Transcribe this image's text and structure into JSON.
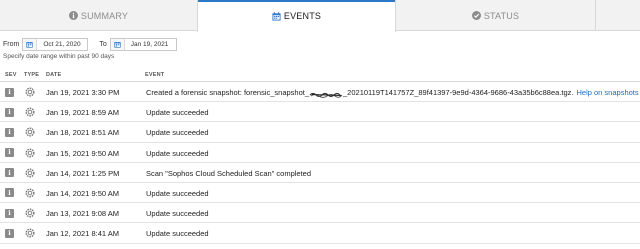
{
  "tabs": [
    {
      "label": "SUMMARY",
      "icon": "info-circle-icon",
      "active": false
    },
    {
      "label": "EVENTS",
      "icon": "calendar-icon",
      "active": true
    },
    {
      "label": "STATUS",
      "icon": "check-circle-icon",
      "active": false
    }
  ],
  "filters": {
    "from_label": "From",
    "from_value": "Oct 21, 2020",
    "to_label": "To",
    "to_value": "Jan 19, 2021",
    "hint": "Specify date range within past 90 days"
  },
  "table": {
    "columns": [
      "SEV",
      "TYPE",
      "DATE",
      "EVENT"
    ],
    "rows": [
      {
        "sev": "i",
        "type_icon": "gear-icon",
        "date": "Jan 19, 2021 3:30 PM",
        "event_prefix": "Created a forensic snapshot: forensic_snapshot_",
        "event_suffix": "_20210119T141757Z_89f41397-9e9d-4364-9686-43a35b6c88ea.tgz.",
        "link": "Help on snapshots"
      },
      {
        "sev": "i",
        "type_icon": "gear-icon",
        "date": "Jan 19, 2021 8:59 AM",
        "event": "Update succeeded"
      },
      {
        "sev": "i",
        "type_icon": "gear-icon",
        "date": "Jan 18, 2021 8:51 AM",
        "event": "Update succeeded"
      },
      {
        "sev": "i",
        "type_icon": "gear-icon",
        "date": "Jan 15, 2021 9:50 AM",
        "event": "Update succeeded"
      },
      {
        "sev": "i",
        "type_icon": "gear-icon",
        "date": "Jan 14, 2021 1:25 PM",
        "event": "Scan \"Sophos Cloud Scheduled Scan\" completed"
      },
      {
        "sev": "i",
        "type_icon": "gear-icon",
        "date": "Jan 14, 2021 9:50 AM",
        "event": "Update succeeded"
      },
      {
        "sev": "i",
        "type_icon": "gear-icon",
        "date": "Jan 13, 2021 9:08 AM",
        "event": "Update succeeded"
      },
      {
        "sev": "i",
        "type_icon": "gear-icon",
        "date": "Jan 12, 2021 8:41 AM",
        "event": "Update succeeded"
      }
    ]
  },
  "colors": {
    "accent": "#2d78c8",
    "link": "#1a6bbf",
    "severity_info": "#8a8a8a"
  }
}
